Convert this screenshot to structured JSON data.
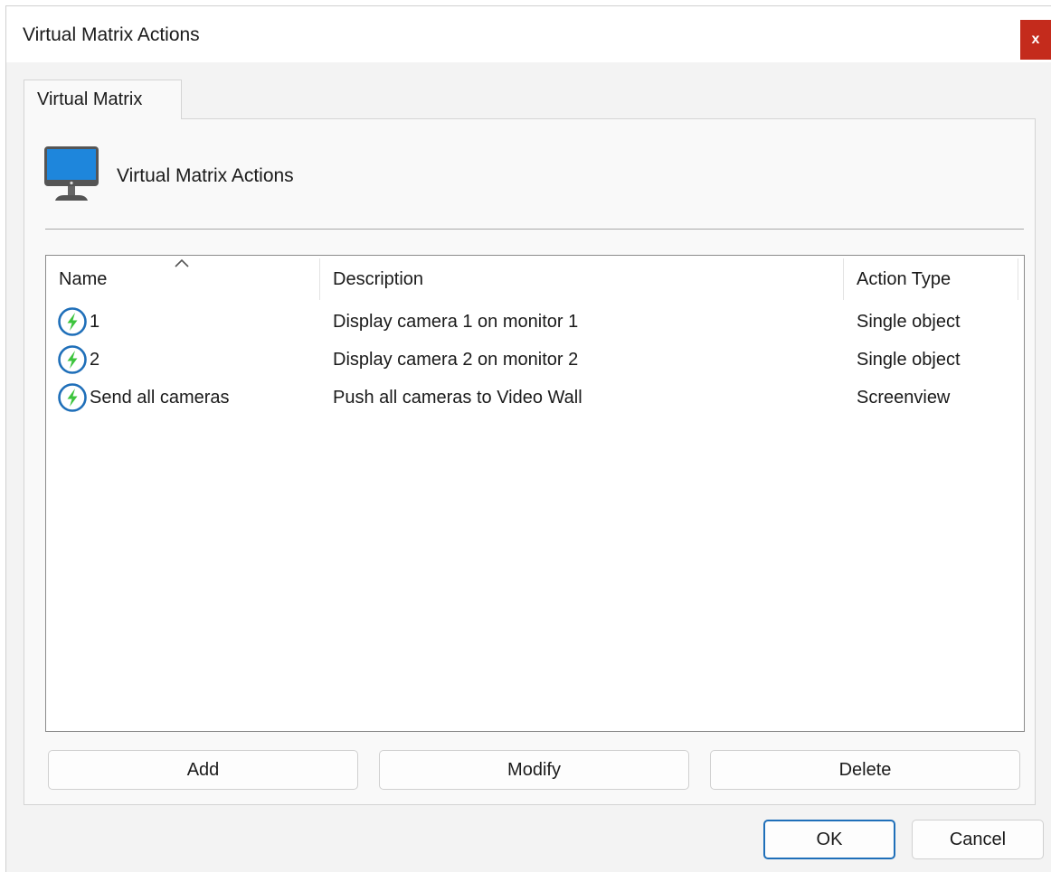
{
  "window": {
    "title": "Virtual Matrix Actions",
    "close_label": "x"
  },
  "tabs": [
    {
      "label": "Virtual Matrix"
    }
  ],
  "panel": {
    "header_title": "Virtual Matrix Actions"
  },
  "list": {
    "columns": [
      "Name",
      "Description",
      "Action Type"
    ],
    "sorted_column": "Name",
    "rows": [
      {
        "name": "1",
        "description": "Display camera 1 on monitor 1",
        "action_type": "Single object",
        "icon": "lightning-action-icon"
      },
      {
        "name": "2",
        "description": "Display camera 2 on monitor 2",
        "action_type": "Single object",
        "icon": "lightning-action-icon"
      },
      {
        "name": "Send all cameras",
        "description": "Push all cameras to Video Wall",
        "action_type": "Screenview",
        "icon": "lightning-action-icon"
      }
    ]
  },
  "buttons": {
    "add": "Add",
    "modify": "Modify",
    "delete": "Delete",
    "ok": "OK",
    "cancel": "Cancel"
  },
  "colors": {
    "accent": "#1f6fb9",
    "close": "#c42b1c",
    "bolt": "#3cc43c",
    "monitor_screen": "#1e86dc"
  }
}
